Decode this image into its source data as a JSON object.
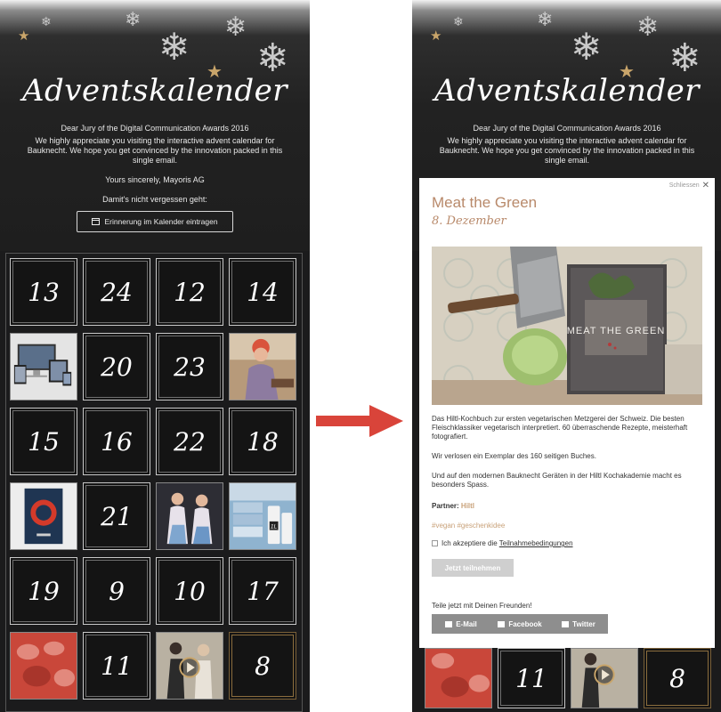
{
  "left": {
    "title": "Adventskalender",
    "intro": {
      "line1": "Dear Jury of the Digital Communication Awards 2016",
      "line2": "We highly appreciate you visiting the interactive advent calendar for Bauknecht. We hope you get convinced by the innovation packed in this single email.",
      "signature": "Yours sincerely, Mayoris AG",
      "reminder": "Damit's nicht vergessen geht:"
    },
    "calendar_button": "Erinnerung im Kalender eintragen",
    "tiles": [
      {
        "type": "number",
        "label": "13"
      },
      {
        "type": "number",
        "label": "24"
      },
      {
        "type": "number",
        "label": "12"
      },
      {
        "type": "number",
        "label": "14"
      },
      {
        "type": "image",
        "image": "devices"
      },
      {
        "type": "number",
        "label": "20"
      },
      {
        "type": "number",
        "label": "23"
      },
      {
        "type": "image",
        "image": "chef-woman"
      },
      {
        "type": "number",
        "label": "15"
      },
      {
        "type": "number",
        "label": "16"
      },
      {
        "type": "number",
        "label": "22"
      },
      {
        "type": "number",
        "label": "18"
      },
      {
        "type": "image",
        "image": "book"
      },
      {
        "type": "number",
        "label": "21"
      },
      {
        "type": "image",
        "image": "two-women"
      },
      {
        "type": "image",
        "image": "laundry"
      },
      {
        "type": "number",
        "label": "19"
      },
      {
        "type": "number",
        "label": "9"
      },
      {
        "type": "number",
        "label": "10"
      },
      {
        "type": "number",
        "label": "17"
      },
      {
        "type": "image",
        "image": "red-molds"
      },
      {
        "type": "number",
        "label": "11"
      },
      {
        "type": "image",
        "image": "video"
      },
      {
        "type": "number",
        "label": "8",
        "style": "gold"
      }
    ]
  },
  "right": {
    "title": "Adventskalender",
    "intro": {
      "line1": "Dear Jury of the Digital Communication Awards 2016",
      "line2": "We highly appreciate you visiting the interactive advent calendar for Bauknecht. We hope you get convinced by the innovation packed in this single email."
    },
    "bottom_tiles": [
      {
        "type": "image",
        "image": "red-molds"
      },
      {
        "type": "number",
        "label": "11"
      },
      {
        "type": "image",
        "image": "video"
      },
      {
        "type": "number",
        "label": "8",
        "style": "gold"
      }
    ],
    "popup": {
      "close_label": "Schliessen",
      "title": "Meat the Green",
      "date": "8. Dezember",
      "book_cover_text": "MEAT THE GREEN",
      "paragraph1": "Das Hiltl-Kochbuch zur ersten vegetarischen Metzgerei der Schweiz. Die besten Fleischklassiker vegetarisch interpretiert. 60 überraschende Rezepte, meisterhaft fotografiert.",
      "paragraph2": "Wir verlosen ein Exemplar des 160 seitigen Buches.",
      "paragraph3": "Und auf den modernen Bauknecht Geräten in der Hiltl Kochakademie macht es besonders Spass.",
      "partner_label": "Partner:",
      "partner_name": "Hiltl",
      "hashtags": "#vegan #geschenkidee",
      "consent_prefix": "Ich akzeptiere die",
      "consent_link": "Teilnahmebedingungen",
      "join_button": "Jetzt teilnehmen",
      "share_prompt": "Teile jetzt mit Deinen Freunden!",
      "share": {
        "email": "E-Mail",
        "facebook": "Facebook",
        "twitter": "Twitter"
      }
    }
  },
  "colors": {
    "accent": "#b8896a",
    "partner": "#c9a27a",
    "hashtag": "#c9a27a",
    "arrow": "#d9443a",
    "star": "#c9a56a"
  }
}
